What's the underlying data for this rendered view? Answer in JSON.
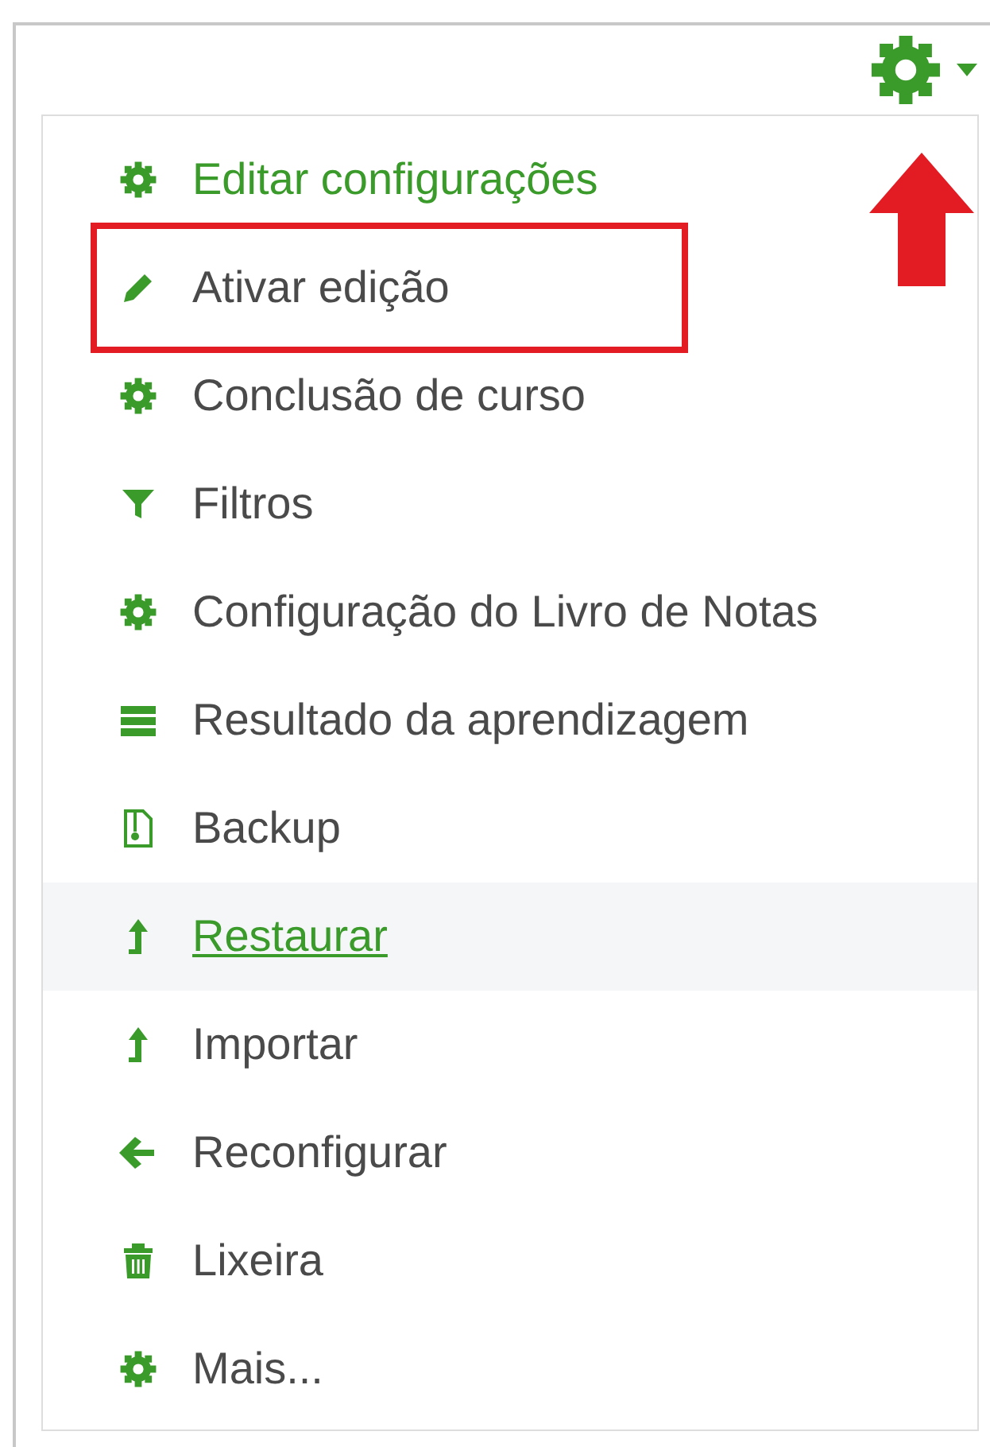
{
  "menu": {
    "items": [
      {
        "label": "Editar configurações",
        "highlighted": true,
        "hovered": false,
        "annotated": false
      },
      {
        "label": "Ativar edição",
        "highlighted": false,
        "hovered": false,
        "annotated": true
      },
      {
        "label": "Conclusão de curso",
        "highlighted": false,
        "hovered": false,
        "annotated": false
      },
      {
        "label": "Filtros",
        "highlighted": false,
        "hovered": false,
        "annotated": false
      },
      {
        "label": "Configuração do Livro de Notas",
        "highlighted": false,
        "hovered": false,
        "annotated": false
      },
      {
        "label": "Resultado da aprendizagem",
        "highlighted": false,
        "hovered": false,
        "annotated": false
      },
      {
        "label": "Backup",
        "highlighted": false,
        "hovered": false,
        "annotated": false
      },
      {
        "label": "Restaurar",
        "highlighted": true,
        "hovered": true,
        "annotated": false
      },
      {
        "label": "Importar",
        "highlighted": false,
        "hovered": false,
        "annotated": false
      },
      {
        "label": "Reconfigurar",
        "highlighted": false,
        "hovered": false,
        "annotated": false
      },
      {
        "label": "Lixeira",
        "highlighted": false,
        "hovered": false,
        "annotated": false
      },
      {
        "label": "Mais...",
        "highlighted": false,
        "hovered": false,
        "annotated": false
      }
    ]
  }
}
